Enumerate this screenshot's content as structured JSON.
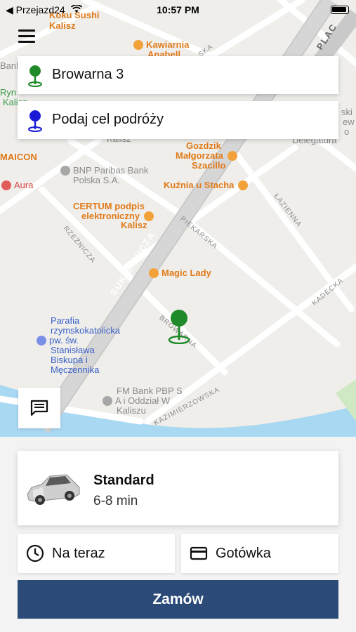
{
  "status_bar": {
    "back_app": "◀ Przejazd24",
    "time": "10:57 PM"
  },
  "map": {
    "pois": [
      {
        "text": "Koku Sushi",
        "color": "orange"
      },
      {
        "text": "Kalisz",
        "color": "orange"
      },
      {
        "text": "Kawiarnia",
        "color": "orange"
      },
      {
        "text": "Anabell",
        "color": "orange"
      },
      {
        "text": "Bank",
        "color": "grey"
      },
      {
        "text": "Ryn",
        "color": "green"
      },
      {
        "text": "Kalisz",
        "color": "green"
      },
      {
        "text": "Kalisz",
        "color": "grey"
      },
      {
        "text": "ski",
        "color": "grey"
      },
      {
        "text": "ew",
        "color": "grey"
      },
      {
        "text": "o",
        "color": "grey"
      },
      {
        "text": "Delegatura",
        "color": "grey"
      },
      {
        "text": "Gozdzik",
        "color": "orange"
      },
      {
        "text": "Małgorzata",
        "color": "orange"
      },
      {
        "text": "Szacillo",
        "color": "orange"
      },
      {
        "text": "MAICON",
        "color": "orange"
      },
      {
        "text": "BNP Paribas Bank",
        "color": "grey"
      },
      {
        "text": "Polska S.A.",
        "color": "grey"
      },
      {
        "text": "Aura",
        "color": "red"
      },
      {
        "text": "Kuźnia u Stacha",
        "color": "orange"
      },
      {
        "text": "CERTUM podpis",
        "color": "orange"
      },
      {
        "text": "elektroniczny",
        "color": "orange"
      },
      {
        "text": "Kalisz",
        "color": "orange"
      },
      {
        "text": "Magic Lady",
        "color": "orange"
      },
      {
        "text": "Parafia",
        "color": "blue"
      },
      {
        "text": "rzymskokatolicka",
        "color": "blue"
      },
      {
        "text": "pw. św.",
        "color": "blue"
      },
      {
        "text": "Stanisława",
        "color": "blue"
      },
      {
        "text": "Biskupa i",
        "color": "blue"
      },
      {
        "text": "Męczennika",
        "color": "blue"
      },
      {
        "text": "FM Bank PBP S",
        "color": "grey"
      },
      {
        "text": "A i Oddział W",
        "color": "grey"
      },
      {
        "text": "Kaliszu",
        "color": "grey"
      }
    ],
    "streets": {
      "sukiennicza": "SUKIENNICZA",
      "rzeznicza": "RZEŹNICZA",
      "piekarska": "PIEKARSKA",
      "lazienna": "ŁAZIENNA",
      "kadecka": "KADECKA",
      "kazimierzowska": "KAZIMIERZOWSKA",
      "browarna": "BROWARNA",
      "plac": "PLAC",
      "ska": "SKA"
    }
  },
  "pickup": {
    "text": "Browarna 3",
    "pin_color": "#1f8a2a"
  },
  "destination": {
    "text": "Podaj cel podróży",
    "pin_color": "#1a1ad6"
  },
  "ride": {
    "name": "Standard",
    "eta": "6-8 min"
  },
  "time_option": "Na teraz",
  "payment_option": "Gotówka",
  "order_button": "Zamów",
  "colors": {
    "order_button": "#2b4a78",
    "pickup_marker": "#1f8a2a"
  }
}
